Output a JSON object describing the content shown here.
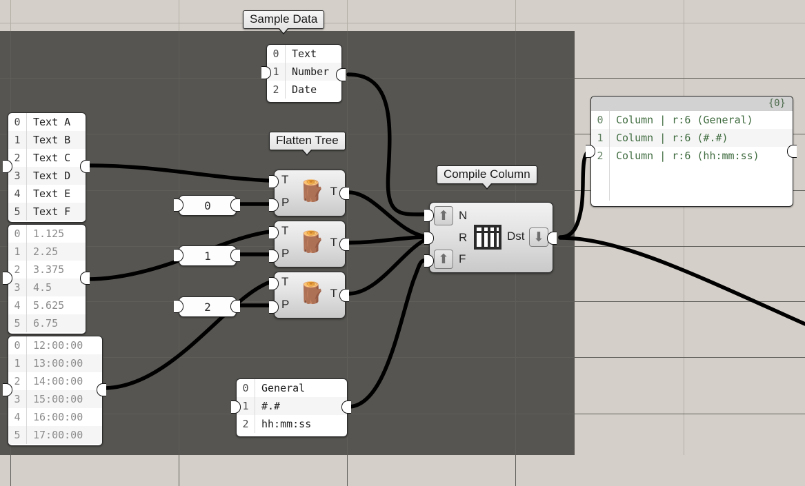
{
  "canvas": {
    "background_color": "#d4cfc8",
    "dark_region_color": "#565551",
    "grid_color": "#b3aea6",
    "wire_color": "#000000"
  },
  "tags": [
    {
      "name": "sample-data",
      "label": "Sample Data"
    },
    {
      "name": "flatten-tree",
      "label": "Flatten Tree"
    },
    {
      "name": "compile-column",
      "label": "Compile Column"
    }
  ],
  "panels": {
    "sample_data": {
      "title": "Sample Data",
      "rows": [
        {
          "index": "0",
          "value": "Text"
        },
        {
          "index": "1",
          "value": "Number"
        },
        {
          "index": "2",
          "value": "Date"
        }
      ]
    },
    "text_list": {
      "rows": [
        {
          "index": "0",
          "value": "Text A"
        },
        {
          "index": "1",
          "value": "Text B"
        },
        {
          "index": "2",
          "value": "Text C"
        },
        {
          "index": "3",
          "value": "Text D"
        },
        {
          "index": "4",
          "value": "Text E"
        },
        {
          "index": "5",
          "value": "Text F"
        }
      ]
    },
    "number_list": {
      "rows": [
        {
          "index": "0",
          "value": "1.125"
        },
        {
          "index": "1",
          "value": "2.25"
        },
        {
          "index": "2",
          "value": "3.375"
        },
        {
          "index": "3",
          "value": "4.5"
        },
        {
          "index": "4",
          "value": "5.625"
        },
        {
          "index": "5",
          "value": "6.75"
        }
      ]
    },
    "time_list": {
      "rows": [
        {
          "index": "0",
          "value": "12:00:00"
        },
        {
          "index": "1",
          "value": "13:00:00"
        },
        {
          "index": "2",
          "value": "14:00:00"
        },
        {
          "index": "3",
          "value": "15:00:00"
        },
        {
          "index": "4",
          "value": "16:00:00"
        },
        {
          "index": "5",
          "value": "17:00:00"
        }
      ]
    },
    "format_list": {
      "rows": [
        {
          "index": "0",
          "value": "General"
        },
        {
          "index": "1",
          "value": "#.#"
        },
        {
          "index": "2",
          "value": "hh:mm:ss"
        }
      ]
    },
    "output_columns": {
      "header": "{0}",
      "rows": [
        {
          "index": "0",
          "value": "Column | r:6 (General)"
        },
        {
          "index": "1",
          "value": "Column | r:6 (#.#)"
        },
        {
          "index": "2",
          "value": "Column | r:6 (hh:mm:ss)"
        }
      ]
    }
  },
  "number_nodes": [
    {
      "name": "number-node-0",
      "value": "0"
    },
    {
      "name": "number-node-1",
      "value": "1"
    },
    {
      "name": "number-node-2",
      "value": "2"
    }
  ],
  "flatten_nodes": [
    {
      "name": "flatten-tree-node-0",
      "in_t": "T",
      "in_p": "P",
      "out_t": "T",
      "icon": "tree-stump-icon"
    },
    {
      "name": "flatten-tree-node-1",
      "in_t": "T",
      "in_p": "P",
      "out_t": "T",
      "icon": "tree-stump-icon"
    },
    {
      "name": "flatten-tree-node-2",
      "in_t": "T",
      "in_p": "P",
      "out_t": "T",
      "icon": "tree-stump-icon"
    }
  ],
  "compile_column_node": {
    "name": "compile-column-node",
    "input_n": "N",
    "input_r": "R",
    "input_f": "F",
    "output": "Dst",
    "icon": "table-columns-icon",
    "btn_n_icon": "arrow-up-icon",
    "btn_f_icon": "arrow-up-icon",
    "btn_dst_icon": "arrow-down-icon"
  }
}
